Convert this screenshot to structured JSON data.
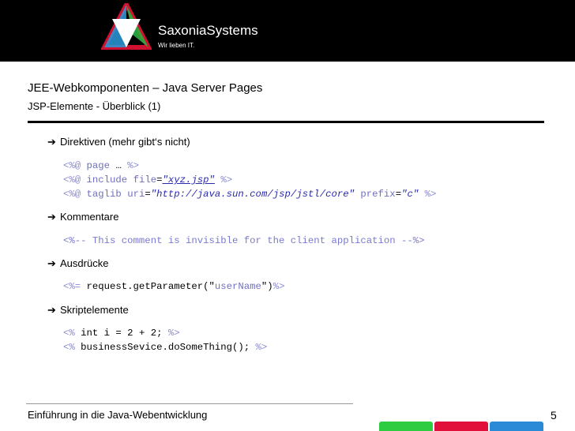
{
  "header": {
    "brand": "SaxoniaSystems",
    "tagline": "Wir lieben IT."
  },
  "slide": {
    "title": "JEE-Webkomponenten – Java Server Pages",
    "subtitle": "JSP-Elemente - Überblick (1)"
  },
  "bullets": {
    "directives": "Direktiven (mehr gibt‘s nicht)",
    "comments": "Kommentare",
    "expressions": "Ausdrücke",
    "scriptlets": "Skriptelemente"
  },
  "code": {
    "d_open": "<%@",
    "d_close": "%>",
    "page_kw": "page",
    "page_rest": " … ",
    "include_kw": "include",
    "file_attr": "file",
    "file_val": "\"xyz.jsp\"",
    "taglib_kw": "taglib",
    "uri_attr": "uri",
    "uri_val": "\"http://java.sun.com/jsp/jstl/core\"",
    "prefix_attr": "prefix",
    "prefix_val": "\"c\"",
    "comment_line": "<%-- This comment is invisible for the client application --%>",
    "expr_open": "<%=",
    "expr_call_pre": " request.getParameter(\"",
    "expr_arg": "userName",
    "expr_call_post": "\")",
    "expr_close": "%>",
    "scr_open": "<%",
    "scr_close": "%>",
    "scriptlet_1": " int i = 2 + 2; ",
    "scriptlet_2": " businessSevice.doSomeThing(); "
  },
  "footer": {
    "text": "Einführung in die Java-Webentwicklung",
    "page_number": "5"
  },
  "colors": {
    "header_bg": "#000000",
    "strip_green": "#2ecc40",
    "strip_red": "#e0103a",
    "strip_blue": "#2a8ad8"
  }
}
